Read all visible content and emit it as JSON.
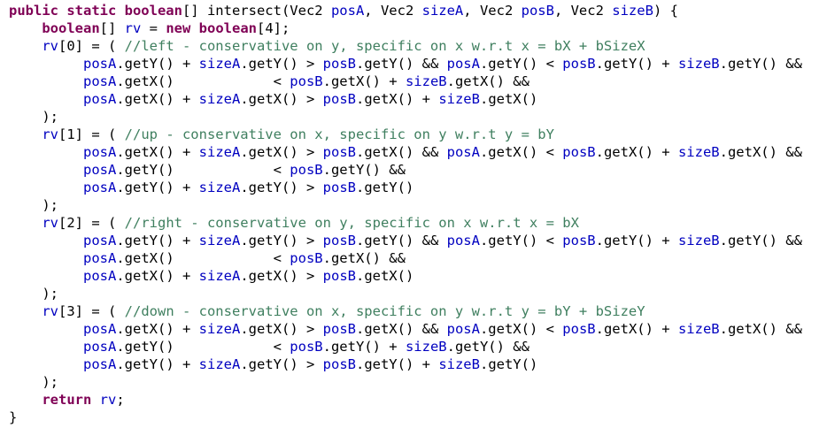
{
  "colors": {
    "keyword": "#7f0055",
    "field": "#0000c0",
    "comment": "#3f7f5f",
    "text": "#000000",
    "background": "#ffffff"
  },
  "lines": [
    {
      "segments": [
        {
          "t": "public static boolean",
          "k": "kw"
        },
        {
          "t": "[] intersect(Vec2 ",
          "k": "tx"
        },
        {
          "t": "posA",
          "k": "fd"
        },
        {
          "t": ", Vec2 ",
          "k": "tx"
        },
        {
          "t": "sizeA",
          "k": "fd"
        },
        {
          "t": ", Vec2 ",
          "k": "tx"
        },
        {
          "t": "posB",
          "k": "fd"
        },
        {
          "t": ", Vec2 ",
          "k": "tx"
        },
        {
          "t": "sizeB",
          "k": "fd"
        },
        {
          "t": ") {",
          "k": "tx"
        }
      ]
    },
    {
      "segments": [
        {
          "t": "    ",
          "k": "tx"
        },
        {
          "t": "boolean",
          "k": "kw"
        },
        {
          "t": "[] ",
          "k": "tx"
        },
        {
          "t": "rv",
          "k": "fd"
        },
        {
          "t": " = ",
          "k": "tx"
        },
        {
          "t": "new boolean",
          "k": "kw"
        },
        {
          "t": "[4];",
          "k": "tx"
        }
      ]
    },
    {
      "segments": [
        {
          "t": "    ",
          "k": "tx"
        },
        {
          "t": "rv",
          "k": "fd"
        },
        {
          "t": "[0] = ( ",
          "k": "tx"
        },
        {
          "t": "//left - conservative on y, specific on x w.r.t x = bX + bSizeX",
          "k": "cm"
        }
      ]
    },
    {
      "segments": [
        {
          "t": "         ",
          "k": "tx"
        },
        {
          "t": "posA",
          "k": "fd"
        },
        {
          "t": ".getY() + ",
          "k": "tx"
        },
        {
          "t": "sizeA",
          "k": "fd"
        },
        {
          "t": ".getY() > ",
          "k": "tx"
        },
        {
          "t": "posB",
          "k": "fd"
        },
        {
          "t": ".getY() && ",
          "k": "tx"
        },
        {
          "t": "posA",
          "k": "fd"
        },
        {
          "t": ".getY() < ",
          "k": "tx"
        },
        {
          "t": "posB",
          "k": "fd"
        },
        {
          "t": ".getY() + ",
          "k": "tx"
        },
        {
          "t": "sizeB",
          "k": "fd"
        },
        {
          "t": ".getY() &&",
          "k": "tx"
        }
      ]
    },
    {
      "segments": [
        {
          "t": "         ",
          "k": "tx"
        },
        {
          "t": "posA",
          "k": "fd"
        },
        {
          "t": ".getX()            < ",
          "k": "tx"
        },
        {
          "t": "posB",
          "k": "fd"
        },
        {
          "t": ".getX() + ",
          "k": "tx"
        },
        {
          "t": "sizeB",
          "k": "fd"
        },
        {
          "t": ".getX() &&",
          "k": "tx"
        }
      ]
    },
    {
      "segments": [
        {
          "t": "         ",
          "k": "tx"
        },
        {
          "t": "posA",
          "k": "fd"
        },
        {
          "t": ".getX() + ",
          "k": "tx"
        },
        {
          "t": "sizeA",
          "k": "fd"
        },
        {
          "t": ".getX() > ",
          "k": "tx"
        },
        {
          "t": "posB",
          "k": "fd"
        },
        {
          "t": ".getX() + ",
          "k": "tx"
        },
        {
          "t": "sizeB",
          "k": "fd"
        },
        {
          "t": ".getX()",
          "k": "tx"
        }
      ]
    },
    {
      "segments": [
        {
          "t": "    );",
          "k": "tx"
        }
      ]
    },
    {
      "segments": [
        {
          "t": "    ",
          "k": "tx"
        },
        {
          "t": "rv",
          "k": "fd"
        },
        {
          "t": "[1] = ( ",
          "k": "tx"
        },
        {
          "t": "//up - conservative on x, specific on y w.r.t y = bY",
          "k": "cm"
        }
      ]
    },
    {
      "segments": [
        {
          "t": "         ",
          "k": "tx"
        },
        {
          "t": "posA",
          "k": "fd"
        },
        {
          "t": ".getX() + ",
          "k": "tx"
        },
        {
          "t": "sizeA",
          "k": "fd"
        },
        {
          "t": ".getX() > ",
          "k": "tx"
        },
        {
          "t": "posB",
          "k": "fd"
        },
        {
          "t": ".getX() && ",
          "k": "tx"
        },
        {
          "t": "posA",
          "k": "fd"
        },
        {
          "t": ".getX() < ",
          "k": "tx"
        },
        {
          "t": "posB",
          "k": "fd"
        },
        {
          "t": ".getX() + ",
          "k": "tx"
        },
        {
          "t": "sizeB",
          "k": "fd"
        },
        {
          "t": ".getX() &&",
          "k": "tx"
        }
      ]
    },
    {
      "segments": [
        {
          "t": "         ",
          "k": "tx"
        },
        {
          "t": "posA",
          "k": "fd"
        },
        {
          "t": ".getY()            < ",
          "k": "tx"
        },
        {
          "t": "posB",
          "k": "fd"
        },
        {
          "t": ".getY() &&",
          "k": "tx"
        }
      ]
    },
    {
      "segments": [
        {
          "t": "         ",
          "k": "tx"
        },
        {
          "t": "posA",
          "k": "fd"
        },
        {
          "t": ".getY() + ",
          "k": "tx"
        },
        {
          "t": "sizeA",
          "k": "fd"
        },
        {
          "t": ".getY() > ",
          "k": "tx"
        },
        {
          "t": "posB",
          "k": "fd"
        },
        {
          "t": ".getY()",
          "k": "tx"
        }
      ]
    },
    {
      "segments": [
        {
          "t": "    );",
          "k": "tx"
        }
      ]
    },
    {
      "segments": [
        {
          "t": "    ",
          "k": "tx"
        },
        {
          "t": "rv",
          "k": "fd"
        },
        {
          "t": "[2] = ( ",
          "k": "tx"
        },
        {
          "t": "//right - conservative on y, specific on x w.r.t x = bX",
          "k": "cm"
        }
      ]
    },
    {
      "segments": [
        {
          "t": "         ",
          "k": "tx"
        },
        {
          "t": "posA",
          "k": "fd"
        },
        {
          "t": ".getY() + ",
          "k": "tx"
        },
        {
          "t": "sizeA",
          "k": "fd"
        },
        {
          "t": ".getY() > ",
          "k": "tx"
        },
        {
          "t": "posB",
          "k": "fd"
        },
        {
          "t": ".getY() && ",
          "k": "tx"
        },
        {
          "t": "posA",
          "k": "fd"
        },
        {
          "t": ".getY() < ",
          "k": "tx"
        },
        {
          "t": "posB",
          "k": "fd"
        },
        {
          "t": ".getY() + ",
          "k": "tx"
        },
        {
          "t": "sizeB",
          "k": "fd"
        },
        {
          "t": ".getY() &&",
          "k": "tx"
        }
      ]
    },
    {
      "segments": [
        {
          "t": "         ",
          "k": "tx"
        },
        {
          "t": "posA",
          "k": "fd"
        },
        {
          "t": ".getX()            < ",
          "k": "tx"
        },
        {
          "t": "posB",
          "k": "fd"
        },
        {
          "t": ".getX() &&",
          "k": "tx"
        }
      ]
    },
    {
      "segments": [
        {
          "t": "         ",
          "k": "tx"
        },
        {
          "t": "posA",
          "k": "fd"
        },
        {
          "t": ".getX() + ",
          "k": "tx"
        },
        {
          "t": "sizeA",
          "k": "fd"
        },
        {
          "t": ".getX() > ",
          "k": "tx"
        },
        {
          "t": "posB",
          "k": "fd"
        },
        {
          "t": ".getX()",
          "k": "tx"
        }
      ]
    },
    {
      "segments": [
        {
          "t": "    );",
          "k": "tx"
        }
      ]
    },
    {
      "segments": [
        {
          "t": "    ",
          "k": "tx"
        },
        {
          "t": "rv",
          "k": "fd"
        },
        {
          "t": "[3] = ( ",
          "k": "tx"
        },
        {
          "t": "//down - conservative on x, specific on y w.r.t y = bY + bSizeY",
          "k": "cm"
        }
      ]
    },
    {
      "segments": [
        {
          "t": "         ",
          "k": "tx"
        },
        {
          "t": "posA",
          "k": "fd"
        },
        {
          "t": ".getX() + ",
          "k": "tx"
        },
        {
          "t": "sizeA",
          "k": "fd"
        },
        {
          "t": ".getX() > ",
          "k": "tx"
        },
        {
          "t": "posB",
          "k": "fd"
        },
        {
          "t": ".getX() && ",
          "k": "tx"
        },
        {
          "t": "posA",
          "k": "fd"
        },
        {
          "t": ".getX() < ",
          "k": "tx"
        },
        {
          "t": "posB",
          "k": "fd"
        },
        {
          "t": ".getX() + ",
          "k": "tx"
        },
        {
          "t": "sizeB",
          "k": "fd"
        },
        {
          "t": ".getX() &&",
          "k": "tx"
        }
      ]
    },
    {
      "segments": [
        {
          "t": "         ",
          "k": "tx"
        },
        {
          "t": "posA",
          "k": "fd"
        },
        {
          "t": ".getY()            < ",
          "k": "tx"
        },
        {
          "t": "posB",
          "k": "fd"
        },
        {
          "t": ".getY() + ",
          "k": "tx"
        },
        {
          "t": "sizeB",
          "k": "fd"
        },
        {
          "t": ".getY() &&",
          "k": "tx"
        }
      ]
    },
    {
      "segments": [
        {
          "t": "         ",
          "k": "tx"
        },
        {
          "t": "posA",
          "k": "fd"
        },
        {
          "t": ".getY() + ",
          "k": "tx"
        },
        {
          "t": "sizeA",
          "k": "fd"
        },
        {
          "t": ".getY() > ",
          "k": "tx"
        },
        {
          "t": "posB",
          "k": "fd"
        },
        {
          "t": ".getY() + ",
          "k": "tx"
        },
        {
          "t": "sizeB",
          "k": "fd"
        },
        {
          "t": ".getY()",
          "k": "tx"
        }
      ]
    },
    {
      "segments": [
        {
          "t": "    );",
          "k": "tx"
        }
      ]
    },
    {
      "segments": [
        {
          "t": "    ",
          "k": "tx"
        },
        {
          "t": "return",
          "k": "kw"
        },
        {
          "t": " ",
          "k": "tx"
        },
        {
          "t": "rv",
          "k": "fd"
        },
        {
          "t": ";",
          "k": "tx"
        }
      ]
    },
    {
      "segments": [
        {
          "t": "}",
          "k": "tx"
        }
      ]
    }
  ]
}
